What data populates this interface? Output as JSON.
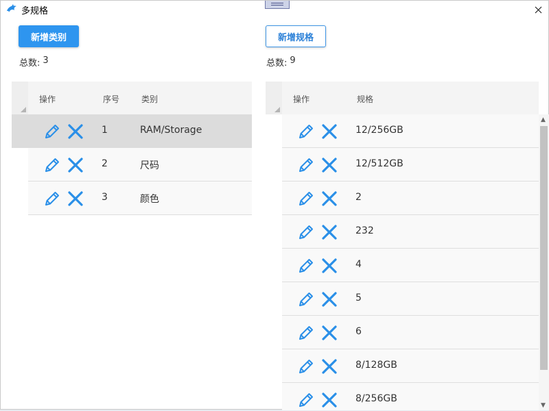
{
  "window": {
    "title": "多规格",
    "close_glyph": "✕"
  },
  "colors": {
    "accent": "#2e95ef",
    "icon_blue": "#2a8fe8",
    "selected_row": "#dcdcdc"
  },
  "left_panel": {
    "add_button_label": "新增类别",
    "count_label": "总数:",
    "count_value": "3",
    "headers": {
      "action": "操作",
      "index": "序号",
      "category": "类别"
    },
    "rows": [
      {
        "index": "1",
        "category": "RAM/Storage",
        "selected": true
      },
      {
        "index": "2",
        "category": "尺码",
        "selected": false
      },
      {
        "index": "3",
        "category": "颜色",
        "selected": false
      }
    ]
  },
  "right_panel": {
    "add_button_label": "新增规格",
    "count_label": "总数:",
    "count_value": "9",
    "headers": {
      "action": "操作",
      "spec": "规格"
    },
    "rows": [
      {
        "spec": "12/256GB"
      },
      {
        "spec": "12/512GB"
      },
      {
        "spec": "2"
      },
      {
        "spec": "232"
      },
      {
        "spec": "4"
      },
      {
        "spec": "5"
      },
      {
        "spec": "6"
      },
      {
        "spec": "8/128GB"
      },
      {
        "spec": "8/256GB"
      }
    ]
  },
  "icons": {
    "edit": "pencil-icon",
    "delete": "close-x-icon",
    "app": "dolphin-icon"
  }
}
